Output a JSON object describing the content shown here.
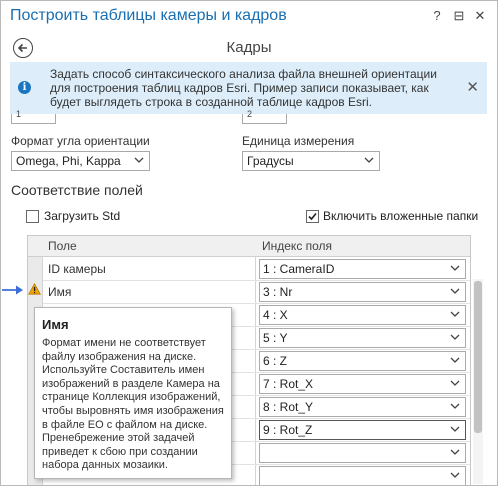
{
  "window": {
    "title": "Построить таблицы камеры и кадров",
    "help_glyph": "?",
    "pin_glyph": "⊟",
    "close_glyph": "✕"
  },
  "page": {
    "title": "Кадры"
  },
  "info": {
    "text": "Задать способ синтаксического анализа файла внешней ориентации для построения таблиц кадров Esri. Пример записи показывает, как будет выглядеть строка в созданной таблице кадров Esri.",
    "close_glyph": "✕"
  },
  "stubs": {
    "left_value": "1",
    "right_value": "2"
  },
  "angle_format": {
    "label": "Формат угла ориентации",
    "value": "Omega, Phi, Kappa"
  },
  "units": {
    "label": "Единица измерения",
    "value": "Градусы"
  },
  "field_mapping": {
    "title": "Соответствие полей",
    "load_std": {
      "label": "Загрузить Std",
      "checked": false
    },
    "include_subfolders": {
      "label": "Включить вложенные папки",
      "checked": true
    },
    "columns": {
      "field": "Поле",
      "index": "Индекс поля"
    },
    "rows": [
      {
        "field": "ID камеры",
        "index": "1 : CameraID"
      },
      {
        "field": "Имя",
        "index": "3 : Nr"
      },
      {
        "field": "",
        "index": "4 : X"
      },
      {
        "field": "",
        "index": "5 : Y"
      },
      {
        "field": "",
        "index": "6 : Z"
      },
      {
        "field": "",
        "index": "7 : Rot_X"
      },
      {
        "field": "",
        "index": "8 : Rot_Y"
      },
      {
        "field": "",
        "index": "9 : Rot_Z"
      },
      {
        "field": "",
        "index": ""
      },
      {
        "field": "",
        "index": ""
      }
    ]
  },
  "tooltip": {
    "title": "Имя",
    "body": "Формат имени не соответствует файлу изображения на диске. Используйте Составитель имен изображений в разделе Камера на странице Коллекция изображений, чтобы выровнять имя изображения в файле EO с файлом на диске. Пренебрежение этой задачей приведет к сбою при создании набора данных мозаики."
  },
  "colors": {
    "accent": "#1a6fb0",
    "info_bg": "#ddeefa",
    "warning": "#f0a30a",
    "arrow": "#3b6fd8"
  }
}
